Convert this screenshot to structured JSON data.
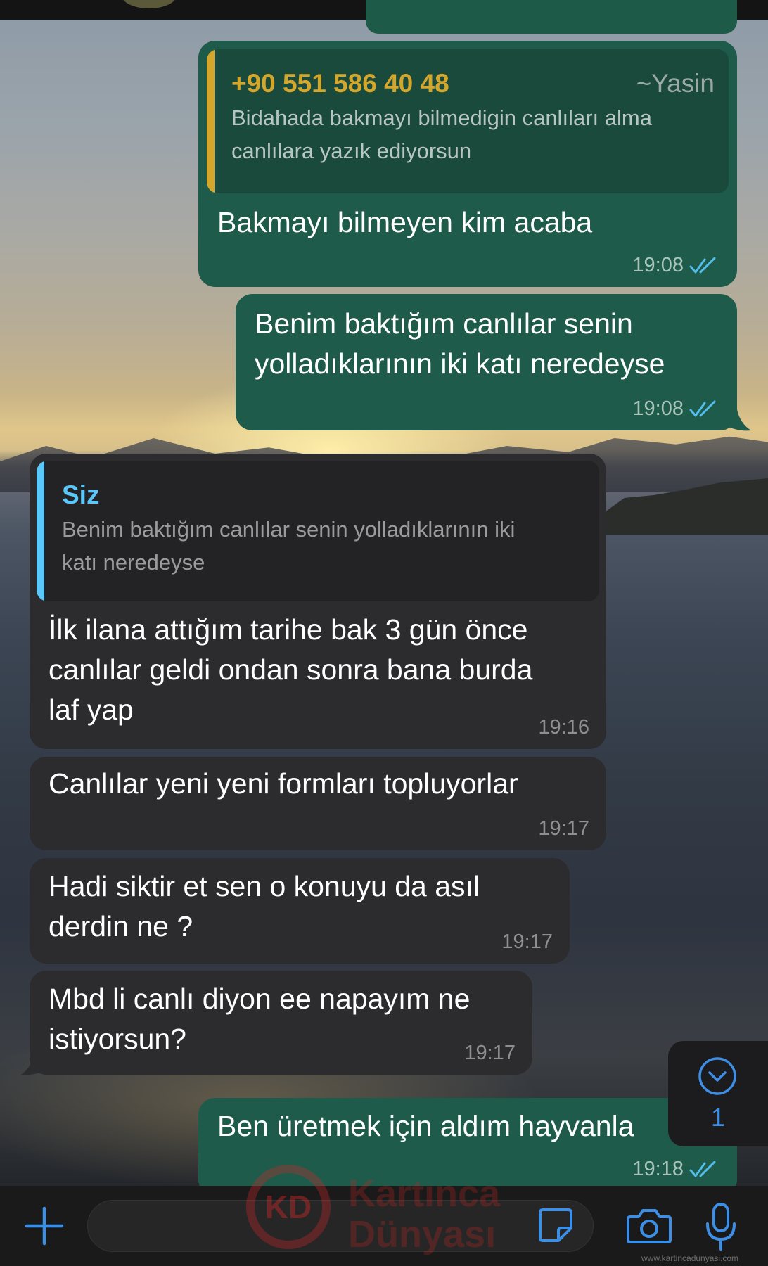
{
  "messages": [
    {
      "direction": "outgoing",
      "quote": {
        "sender_number": "+90 551 586 40 48",
        "sender_name": "~Yasin",
        "text": "Bidahada bakmayı bilmedigin canlıları alma\ncanlılara yazık ediyorsun"
      },
      "text": "Bakmayı bilmeyen kim acaba",
      "time": "19:08",
      "status": "read"
    },
    {
      "direction": "outgoing",
      "text": "Benim baktığım canlılar senin\nyolladıklarının iki katı neredeyse",
      "time": "19:08",
      "status": "read"
    },
    {
      "direction": "incoming",
      "quote": {
        "sender_name": "Siz",
        "text": "Benim baktığım canlılar senin yolladıklarının iki\nkatı neredeyse"
      },
      "text": "İlk ilana attığım tarihe bak 3 gün önce\ncanlılar geldi ondan sonra bana burda\nlaf yap",
      "time": "19:16"
    },
    {
      "direction": "incoming",
      "text": "Canlılar yeni yeni formları topluyorlar",
      "time": "19:17"
    },
    {
      "direction": "incoming",
      "text": "Hadi siktir et sen o konuyu da asıl\nderdin ne ?",
      "time": "19:17"
    },
    {
      "direction": "incoming",
      "text": "Mbd li canlı diyon ee napayım ne\nistiyorsun?",
      "time": "19:17"
    },
    {
      "direction": "outgoing",
      "text": "Ben üretmek için aldım hayvanla",
      "time": "19:18",
      "status": "read"
    }
  ],
  "scroll_down": {
    "icon": "chevron-down-circle-icon",
    "unread_count": "1"
  },
  "input_bar": {
    "icons": [
      "plus-icon",
      "sticker-icon",
      "camera-icon",
      "microphone-icon"
    ]
  },
  "watermark": {
    "logo_text": "KD",
    "line1": "Kartınca",
    "line2": "Dünyası",
    "url": "www.kartincadunyasi.com"
  },
  "colors": {
    "outgoing_bubble": "#1f5b4a",
    "incoming_bubble": "#2c2c2e",
    "quote_outgoing_bar": "#d4a72c",
    "quote_incoming_bar": "#5ac8fa",
    "accent_blue": "#3d8fe6",
    "read_ticks": "#53bdeb"
  }
}
